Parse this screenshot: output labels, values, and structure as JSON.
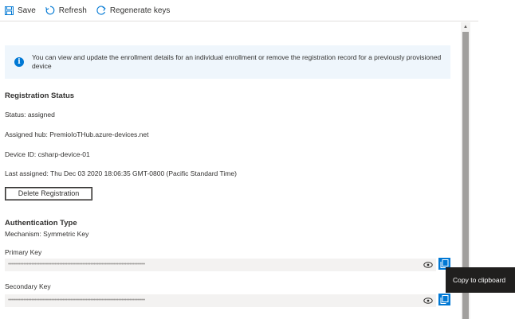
{
  "toolbar": {
    "save_label": "Save",
    "refresh_label": "Refresh",
    "regenerate_label": "Regenerate keys"
  },
  "info": {
    "message": "You can view and update the enrollment details for an individual enrollment or remove the registration record for a previously provisioned device"
  },
  "registration": {
    "title": "Registration Status",
    "status": "Status: assigned",
    "assigned_hub": "Assigned hub: PremioIoTHub.azure-devices.net",
    "device_id": "Device ID: csharp-device-01",
    "last_assigned": "Last assigned: Thu Dec 03 2020 18:06:35 GMT-0800 (Pacific Standard Time)",
    "delete_label": "Delete Registration"
  },
  "authentication": {
    "title": "Authentication Type",
    "mechanism": "Mechanism: Symmetric Key",
    "primary_label": "Primary Key",
    "primary_value": "••••••••••••••••••••••••••••••••••••••••••••••••••••••••••••••••••••••••••••••••••••••••",
    "secondary_label": "Secondary Key",
    "secondary_value": "••••••••••••••••••••••••••••••••••••••••••••••••••••••••••••••••••••••••••••••••••••••••"
  },
  "tooltip": {
    "text": "Copy to clipboard"
  },
  "colors": {
    "accent": "#0078d4",
    "info_background": "#eff6fc",
    "field_background": "#f3f2f1",
    "tooltip_background": "#201f1e"
  },
  "icons": [
    "save-icon",
    "refresh-icon",
    "regenerate-icon",
    "info-icon",
    "eye-icon",
    "copy-icon"
  ]
}
